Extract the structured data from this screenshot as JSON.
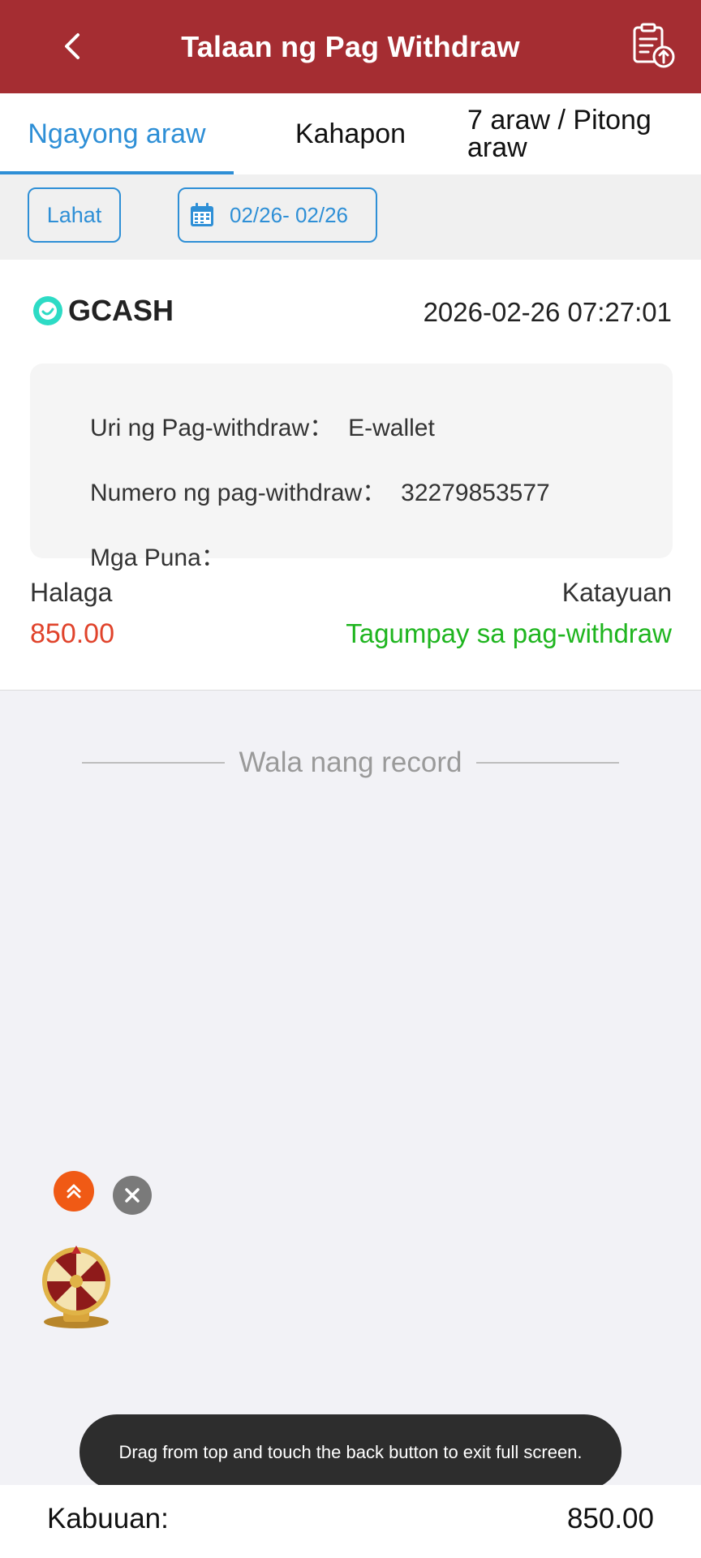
{
  "header": {
    "title": "Talaan ng Pag Withdraw",
    "back_icon": "chevron-left-icon",
    "right_icon": "clipboard-upload-icon",
    "background": "#a52d32"
  },
  "tabs": [
    {
      "label": "Ngayong araw",
      "active": true
    },
    {
      "label": "Kahapon",
      "active": false
    },
    {
      "label": "7 araw / Pitong araw",
      "active": false
    }
  ],
  "filters": {
    "all_label": "Lahat",
    "date_range": "02/26- 02/26",
    "accent": "#2e8fd6"
  },
  "record": {
    "method": "GCASH",
    "datetime": "2026-02-26 07:27:01",
    "type_label": "Uri ng Pag-withdraw：",
    "type_value": "E-wallet",
    "number_label": "Numero ng pag-withdraw：",
    "number_value": "32279853577",
    "remarks_label": "Mga Puna：",
    "remarks_value": "",
    "amount_label": "Halaga",
    "amount_value": "850.00",
    "status_label": "Katayuan",
    "status_value": "Tagumpay sa pag-withdraw",
    "amount_color": "#e0432b",
    "status_color": "#1fb51f"
  },
  "empty_state": "Wala nang record",
  "toast": "Drag from top and touch the back button to exit full screen.",
  "footer": {
    "total_label": "Kabuuan:",
    "total_value": "850.00"
  }
}
